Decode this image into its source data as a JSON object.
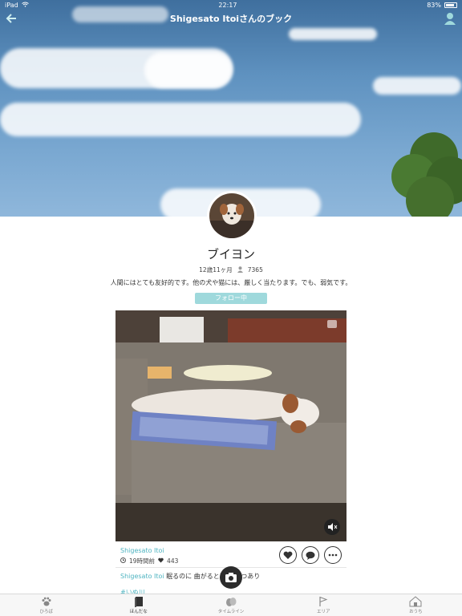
{
  "status_bar": {
    "device": "iPad",
    "time": "22:17",
    "battery": "83%"
  },
  "nav": {
    "title": "Shigesato  Itoiさんのブック"
  },
  "profile": {
    "name": "ブイヨン",
    "age": "12歳11ヶ月",
    "followers": "7365",
    "description": "人間にはとても友好的です。他の犬や猫には、厳しく当たります。でも、弱気です。",
    "follow_label": "フォロー中"
  },
  "post": {
    "author": "Shigesato  Itoi",
    "time_ago": "19時間前",
    "likes": "443",
    "comment_author": "Shigesato  Itoi",
    "comment_text": "眠るのに 曲がると真面… つあり",
    "hashtag": "#いぬ川"
  },
  "tabs": [
    {
      "label": "ひろば",
      "icon": "paw-icon"
    },
    {
      "label": "ほんだな",
      "icon": "book-icon",
      "active": true
    },
    {
      "label": "タイムライン",
      "icon": "timeline-icon"
    },
    {
      "label": "エリア",
      "icon": "flag-icon"
    },
    {
      "label": "おうち",
      "icon": "house-icon"
    }
  ],
  "colors": {
    "accent": "#4fb4c1",
    "follow_button": "#9fd9dc",
    "sky": "#5f92c0"
  }
}
